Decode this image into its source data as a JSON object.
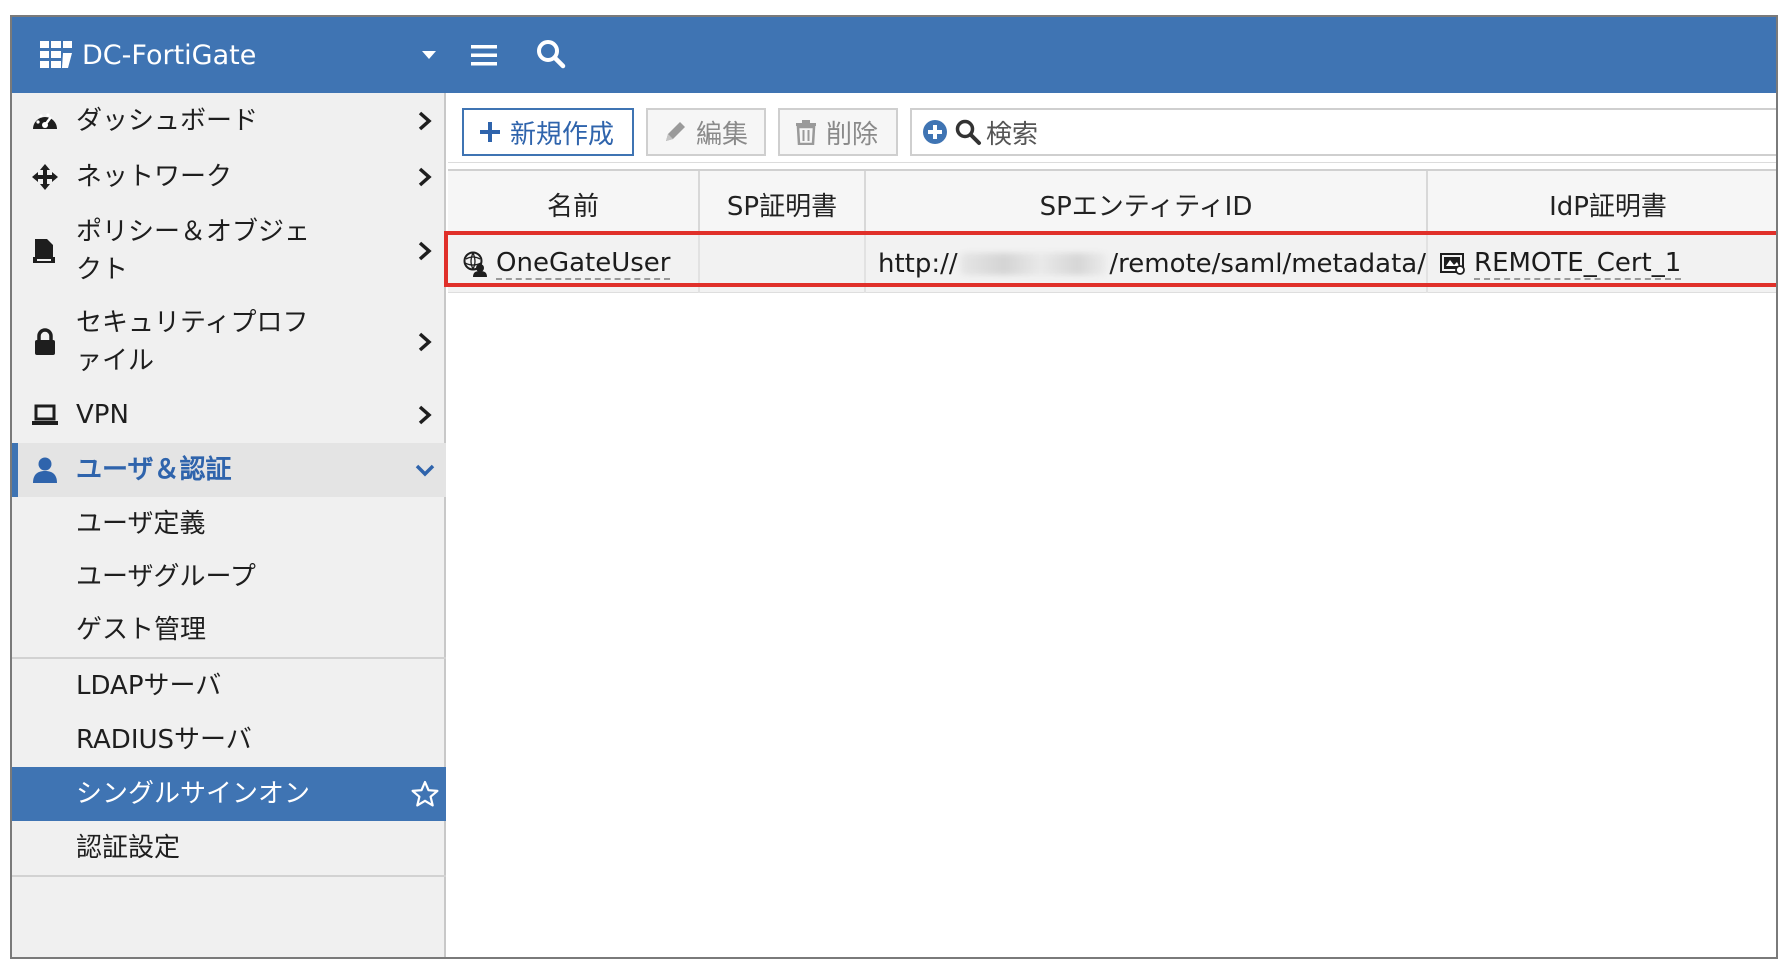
{
  "header": {
    "device_name": "DC-FortiGate",
    "logo_icon": "fortinet-logo-icon",
    "menu_icon": "hamburger-icon",
    "search_icon": "search-icon"
  },
  "sidebar": {
    "items": [
      {
        "label": "ダッシュボード",
        "icon": "dashboard-icon"
      },
      {
        "label": "ネットワーク",
        "icon": "network-move-icon"
      },
      {
        "label": "ポリシー＆オブジェクト",
        "icon": "policy-icon"
      },
      {
        "label": "セキュリティプロファイル",
        "icon": "lock-icon"
      },
      {
        "label": "VPN",
        "icon": "laptop-icon"
      },
      {
        "label": "ユーザ＆認証",
        "icon": "user-icon"
      }
    ],
    "subitems": [
      {
        "label": "ユーザ定義"
      },
      {
        "label": "ユーザグループ"
      },
      {
        "label": "ゲスト管理"
      },
      {
        "label": "LDAPサーバ"
      },
      {
        "label": "RADIUSサーバ"
      },
      {
        "label": "シングルサインオン",
        "selected": true
      },
      {
        "label": "認証設定"
      }
    ]
  },
  "toolbar": {
    "new_label": "新規作成",
    "edit_label": "編集",
    "delete_label": "削除",
    "search_label": "検索"
  },
  "table": {
    "columns": [
      "名前",
      "SP証明書",
      "SPエンティティID",
      "IdP証明書"
    ],
    "rows": [
      {
        "name": "OneGateUser",
        "sp_cert": "",
        "sp_entity_prefix": "http://",
        "sp_entity_suffix": "/remote/saml/metadata/",
        "idp_cert": "REMOTE_Cert_1"
      }
    ]
  },
  "colors": {
    "brand_blue": "#3f74b3",
    "highlight_red": "#e0302a"
  }
}
